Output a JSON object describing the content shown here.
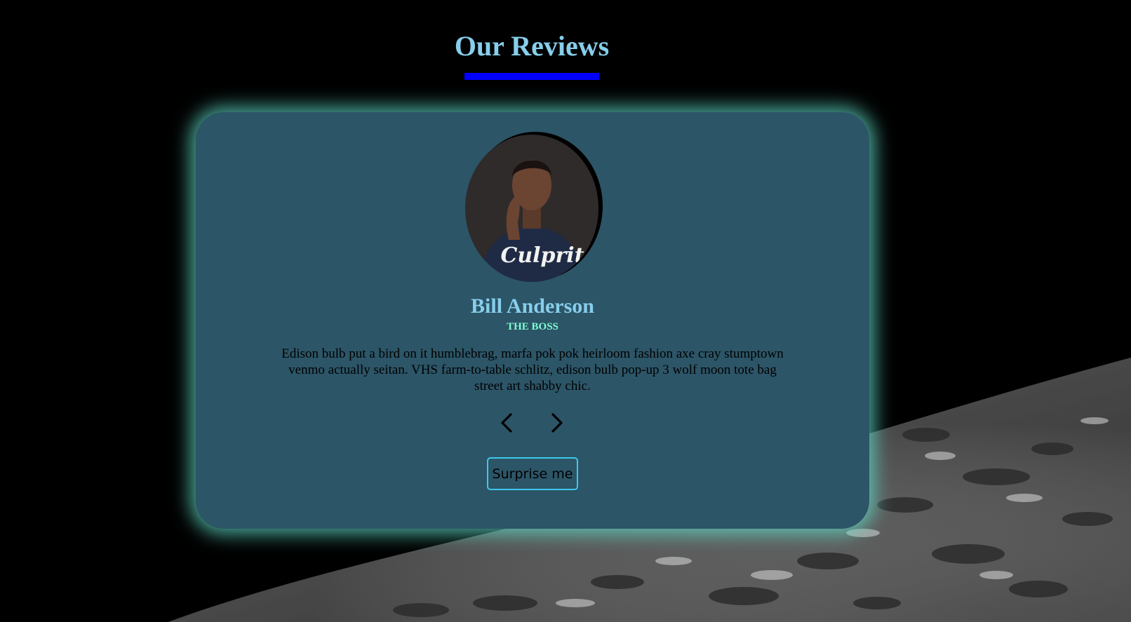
{
  "page": {
    "title": "Our Reviews"
  },
  "review": {
    "name": "Bill Anderson",
    "job": "THE BOSS",
    "text": "Edison bulb put a bird on it humblebrag, marfa pok pok heirloom fashion axe cray stumptown venmo actually seitan. VHS farm-to-table schlitz, edison bulb pop-up 3 wolf moon tote bag street art shabby chic.",
    "shirt_text": "Culprit"
  },
  "controls": {
    "prev_icon": "chevron-left-icon",
    "next_icon": "chevron-right-icon",
    "random_label": "Surprise me"
  },
  "colors": {
    "title": "#87ceeb",
    "underline": "#0000ff",
    "card_bg": "#2c5567",
    "card_glow": "#60dcc8",
    "job": "#7fffd4",
    "button_border": "#3ec8ec"
  }
}
